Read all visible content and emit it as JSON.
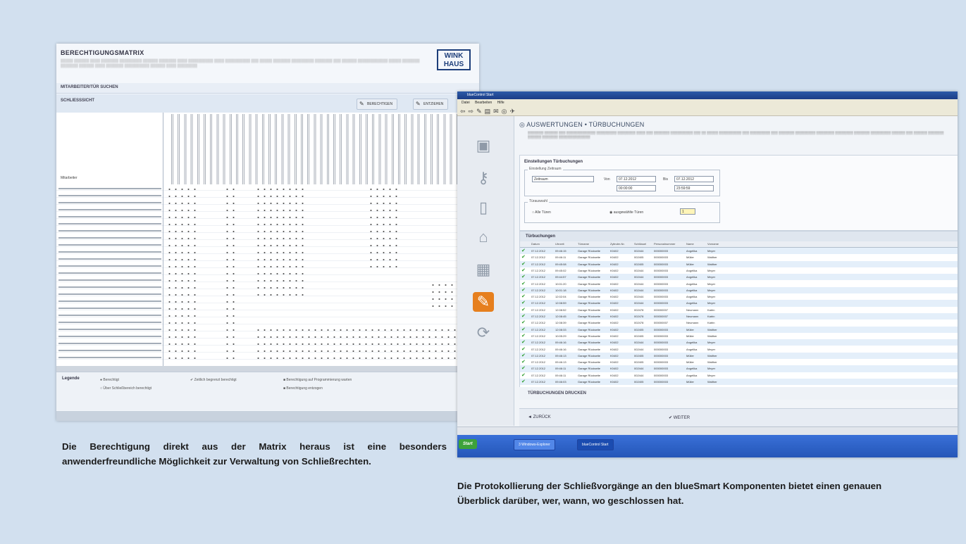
{
  "colors": {
    "background": "#d2e0ef",
    "accent": "#e67f1e",
    "ok": "#2e9d2e"
  },
  "shot1": {
    "title": "BERECHTIGUNGSMATRIX",
    "logo": "WINKHAUS",
    "section1": "MITARBEITER/TÜR SUCHEN",
    "section2": "SCHLIESSSICHT",
    "btn1": "BERECHTIGEN",
    "btn2": "ENTZIEHEN",
    "row_header": "Mitarbeiter",
    "legend": {
      "title": "Legende",
      "items": [
        "Berechtigt",
        "Über Schließbereich berechtigt",
        "Zeitlich begrenzt berechtigt",
        "Berechtigung auf Programmierung warten",
        "Berechtigung entzogen"
      ]
    }
  },
  "shot2": {
    "window_title": "blueControl Start",
    "menu": [
      "Datei",
      "Bearbeiten",
      "Hilfe"
    ],
    "heading": "AUSWERTUNGEN • TÜRBUCHUNGEN",
    "settings": {
      "title": "Einstellungen Türbuchungen",
      "group1": "Einstellung Zeitraum",
      "mode": "Zeitraum",
      "from_label": "Von",
      "to_label": "Bis",
      "from_date": "07.12.2012",
      "to_date": "07.12.2012",
      "from_time": "00:00:00",
      "to_time": "23:59:59",
      "group2": "Türauswahl",
      "opt_all": "Alle Türen",
      "opt_sel": "ausgewählte Türen",
      "sel_count": "1"
    },
    "table": {
      "title": "Türbuchungen",
      "columns": [
        "Datum",
        "Uhrzeit",
        "Türname",
        "Zylinder-Nr.",
        "Schlüssel",
        "Personalnummer",
        "Name",
        "Vorname"
      ],
      "rows": [
        [
          "07.12.2012",
          "09:46:15",
          "Garage Rückseite",
          "K0402",
          "002444",
          "000000003",
          "Angelika",
          "Meyer"
        ],
        [
          "07.12.2012",
          "09:46:11",
          "Garage Rückseite",
          "K0402",
          "002405",
          "000000003",
          "Müller",
          "Walther"
        ],
        [
          "07.12.2012",
          "09:45:08",
          "Garage Rückseite",
          "K0402",
          "002405",
          "000000003",
          "Müller",
          "Walther"
        ],
        [
          "07.12.2012",
          "09:45:02",
          "Garage Rückseite",
          "K0402",
          "002444",
          "000000003",
          "Angelika",
          "Meyer"
        ],
        [
          "07.12.2012",
          "09:44:57",
          "Garage Rückseite",
          "K0402",
          "002444",
          "000000003",
          "Angelika",
          "Meyer"
        ],
        [
          "07.12.2012",
          "10:01:20",
          "Garage Rückseite",
          "K0402",
          "002444",
          "000000003",
          "Angelika",
          "Meyer"
        ],
        [
          "07.12.2012",
          "10:01:18",
          "Garage Rückseite",
          "K0402",
          "002444",
          "000000003",
          "Angelika",
          "Meyer"
        ],
        [
          "07.12.2012",
          "12:02:04",
          "Garage Rückseite",
          "K0402",
          "002444",
          "000000003",
          "Angelika",
          "Meyer"
        ],
        [
          "07.12.2012",
          "12:08:59",
          "Garage Rückseite",
          "K0402",
          "002444",
          "000000003",
          "Angelika",
          "Meyer"
        ],
        [
          "07.12.2012",
          "12:08:52",
          "Garage Rückseite",
          "K0402",
          "002478",
          "000000007",
          "Neumann",
          "Katrin"
        ],
        [
          "07.12.2012",
          "12:08:45",
          "Garage Rückseite",
          "K0402",
          "002478",
          "000000007",
          "Neumann",
          "Katrin"
        ],
        [
          "07.12.2012",
          "12:08:39",
          "Garage Rückseite",
          "K0402",
          "002478",
          "000000007",
          "Neumann",
          "Katrin"
        ],
        [
          "07.12.2012",
          "12:08:33",
          "Garage Rückseite",
          "K0402",
          "002405",
          "000000003",
          "Müller",
          "Walther"
        ],
        [
          "07.12.2012",
          "10:05:29",
          "Garage Rückseite",
          "K0402",
          "002405",
          "000000003",
          "Müller",
          "Walther"
        ],
        [
          "07.12.2012",
          "09:46:16",
          "Garage Rückseite",
          "K0402",
          "002444",
          "000000003",
          "Angelika",
          "Meyer"
        ],
        [
          "07.12.2012",
          "09:46:16",
          "Garage Rückseite",
          "K0402",
          "002444",
          "000000003",
          "Angelika",
          "Meyer"
        ],
        [
          "07.12.2012",
          "09:46:13",
          "Garage Rückseite",
          "K0402",
          "002405",
          "000000003",
          "Müller",
          "Walther"
        ],
        [
          "07.12.2012",
          "09:46:13",
          "Garage Rückseite",
          "K0402",
          "002405",
          "000000003",
          "Müller",
          "Walther"
        ],
        [
          "07.12.2012",
          "09:46:11",
          "Garage Rückseite",
          "K0402",
          "002444",
          "000000003",
          "Angelika",
          "Meyer"
        ],
        [
          "07.12.2012",
          "09:46:11",
          "Garage Rückseite",
          "K0402",
          "002444",
          "000000003",
          "Angelika",
          "Meyer"
        ],
        [
          "07.12.2012",
          "09:46:03",
          "Garage Rückseite",
          "K0402",
          "002405",
          "000000003",
          "Müller",
          "Walther"
        ]
      ]
    },
    "print_label": "TÜRBUCHUNGEN DRUCKEN",
    "back_label": "◄ ZURÜCK",
    "next_label": "✔ WEITER",
    "taskbar": {
      "start": "Start",
      "task1": "3 Windows-Explorer",
      "task2": "blueControl Start"
    }
  },
  "captions": {
    "left": "Die Berechtigung direkt aus der Matrix heraus ist eine besonders anwenderfreundliche Möglichkeit zur Verwaltung von Schließrechten.",
    "right": "Die Protokollierung der Schließvorgänge an den blueSmart Komponenten bietet einen genauen Überblick darüber, wer, wann, wo geschlossen hat."
  }
}
